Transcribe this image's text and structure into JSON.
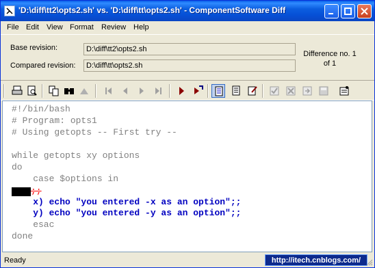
{
  "window": {
    "title": "'D:\\diff\\tt2\\opts2.sh' vs. 'D:\\diff\\tt\\opts2.sh' - ComponentSoftware Diff"
  },
  "menu": [
    "File",
    "Edit",
    "View",
    "Format",
    "Review",
    "Help"
  ],
  "info": {
    "base_label": "Base revision:",
    "base_value": "D:\\diff\\tt2\\opts2.sh",
    "compared_label": "Compared revision:",
    "compared_value": "D:\\diff\\tt\\opts2.sh",
    "difference_line1": "Difference no. 1",
    "difference_line2": "of 1"
  },
  "toolbar": {
    "icons": [
      "print-icon",
      "print-preview-icon",
      "copy-icon",
      "find-icon",
      "disabled-tool-icon",
      "first-diff-icon",
      "prev-diff-icon",
      "next-diff-icon",
      "last-diff-icon",
      "play-icon",
      "next-change-icon",
      "single-view-icon",
      "split-view-icon",
      "edit-view-icon",
      "accept-icon",
      "reject-icon",
      "apply-icon",
      "save-icon",
      "options-icon"
    ]
  },
  "code": {
    "lines": [
      "#!/bin/bash",
      "# Program: opts1",
      "# Using getopts -- First try --",
      "",
      "while getopts xy options",
      "do",
      "    case $options in"
    ],
    "deleted": ";;",
    "added": [
      "    x) echo \"you entered -x as an option\";;",
      "    y) echo \"you entered -y as an option\";;"
    ],
    "after": [
      "    esac",
      "done"
    ]
  },
  "colors": {
    "added_text": "#0000c0",
    "deleted_text": "#ff0000",
    "context_text": "#808080"
  },
  "status": {
    "text": "Ready",
    "url": "http://itech.cnblogs.com/"
  }
}
